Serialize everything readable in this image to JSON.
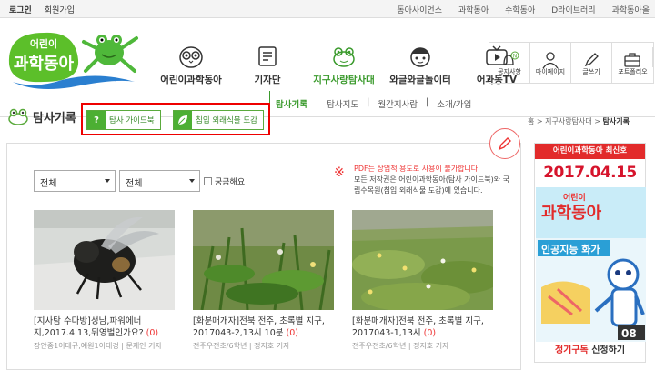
{
  "topbar": {
    "left": [
      "로그인",
      "회원가입"
    ],
    "right": [
      "동아사이언스",
      "과학동아",
      "수학동아",
      "D라이브러리",
      "과학동아올"
    ]
  },
  "logo": {
    "small": "어린이",
    "big": "과학동아"
  },
  "nav": [
    {
      "label": "어린이과학동아",
      "icon": "owl-icon"
    },
    {
      "label": "기자단",
      "icon": "notepad-icon"
    },
    {
      "label": "지구사랑탐사대",
      "icon": "frog-icon",
      "active": true
    },
    {
      "label": "와글와글놀이터",
      "icon": "character-icon"
    },
    {
      "label": "어과동TV",
      "icon": "tv-icon"
    }
  ],
  "util": [
    {
      "label": "공지사항",
      "icon": "bell-icon",
      "badge": "N"
    },
    {
      "label": "마이페이지",
      "icon": "person-icon"
    },
    {
      "label": "글쓰기",
      "icon": "pencil-icon"
    },
    {
      "label": "포트폴리오",
      "icon": "briefcase-icon"
    }
  ],
  "subnav": [
    "탐사기록",
    "탐사지도",
    "월간지사람",
    "소개/가입"
  ],
  "page_title": "탐사기록",
  "guide_buttons": [
    "탐사 가이드북",
    "침입 외래식물 도감"
  ],
  "guide_icons": [
    "?",
    "leaf"
  ],
  "breadcrumb": {
    "home": "홈",
    "sep": ">",
    "mid": "지구사랑탐사대",
    "current": "탐사기록"
  },
  "filters": {
    "select1": "전체",
    "select2": "전체",
    "checkbox_label": "궁금해요"
  },
  "notice": {
    "star": "※",
    "red": "PDF는 상업적 용도로 사용이 불가합니다.",
    "text": "모든 저작권은 어린이과학동아(탐사 가이드북)와 국립수목원(침입 외래식물 도감)에 있습니다."
  },
  "cards": [
    {
      "title": "[지사탐 수다방]성남,파워에너지,2017.4.13,뒤영벌인가요?",
      "count": "(0)",
      "meta": "장안중1이태규,예원1이태경 | 문재인 기자"
    },
    {
      "title": "[화분매개자]전북 전주, 초록별 지구, 2017043-2,13시 10분",
      "count": "(0)",
      "meta": "전주우전초/6학년 | 정지호 기자"
    },
    {
      "title": "[화분매개자]전북 전주, 초록별 지구, 2017043-1,13시",
      "count": "(0)",
      "meta": "전주우전초/6학년 | 정지호 기자"
    }
  ],
  "sidebar": {
    "header": "어린이과학동아 최신호",
    "date": "2017.04.15",
    "cover_small": "어린이",
    "cover_big": "과학동아",
    "cover_headline": "인공지능 화가",
    "cover_issue": "08",
    "subscribe_red": "정기구독",
    "subscribe_rest": " 신청하기"
  },
  "colors": {
    "accent": "#3a9a2c",
    "red": "#e22b2b",
    "highlight_box": "#ee0000"
  }
}
